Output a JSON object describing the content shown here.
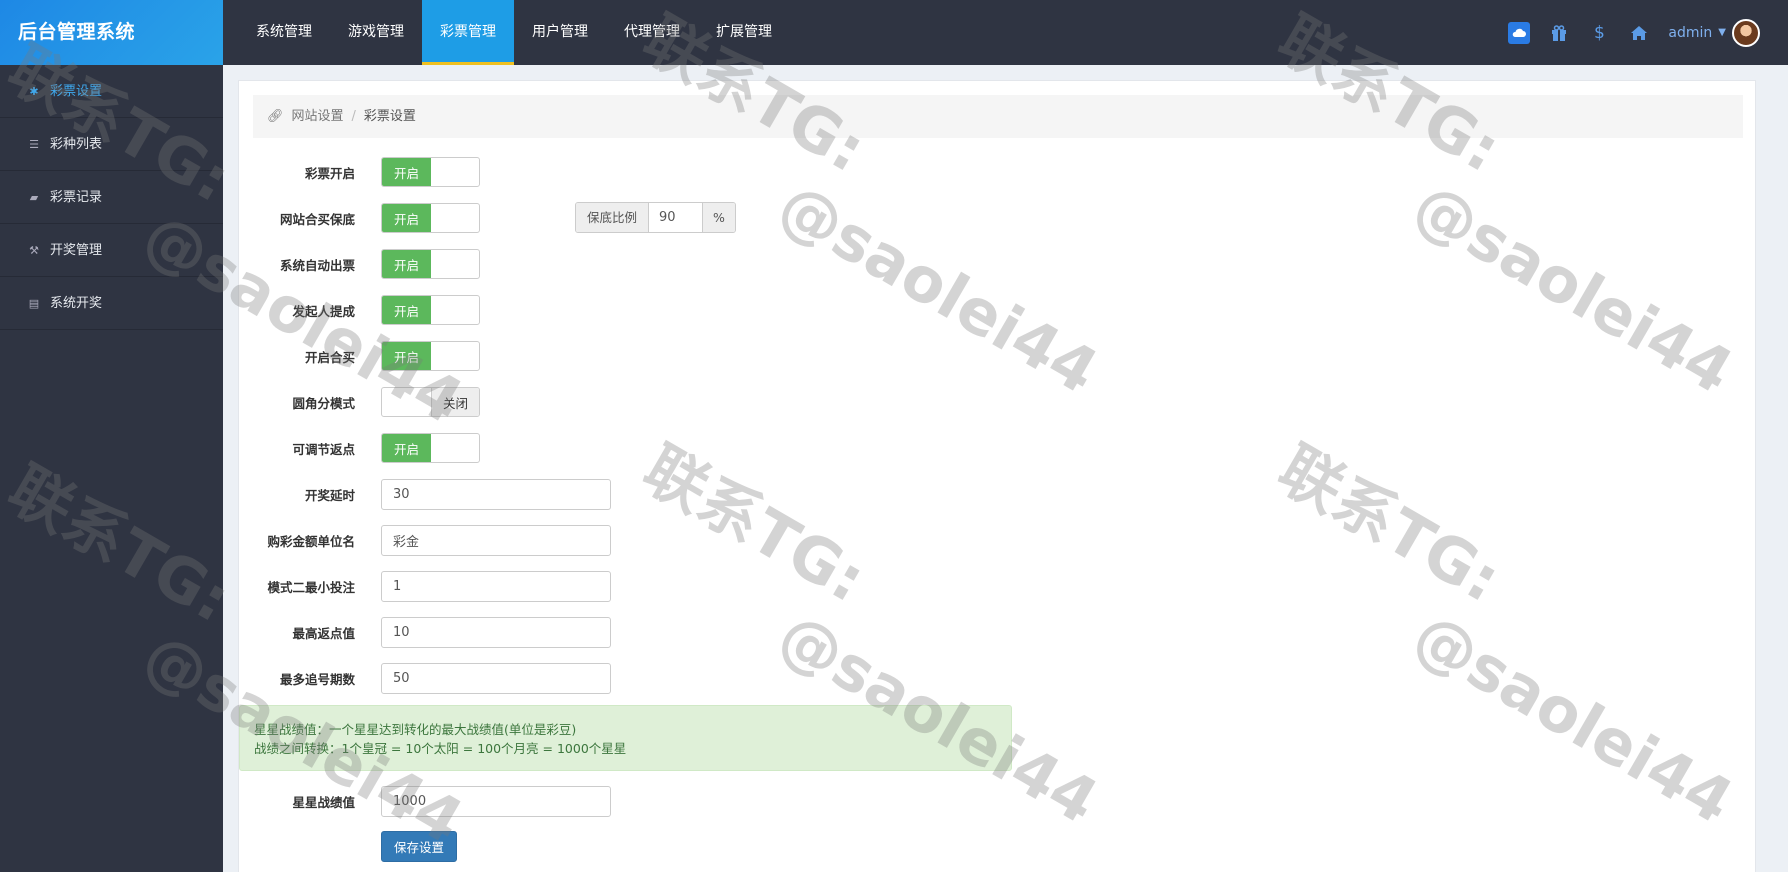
{
  "brand": "后台管理系统",
  "topnav": [
    {
      "label": "系统管理",
      "active": false
    },
    {
      "label": "游戏管理",
      "active": false
    },
    {
      "label": "彩票管理",
      "active": true
    },
    {
      "label": "用户管理",
      "active": false
    },
    {
      "label": "代理管理",
      "active": false
    },
    {
      "label": "扩展管理",
      "active": false
    }
  ],
  "topright": {
    "user": "admin",
    "icons": [
      "cloud-icon",
      "gift-icon",
      "dollar-icon",
      "home-icon"
    ]
  },
  "sidebar": [
    {
      "label": "彩票设置",
      "icon": "gear-icon",
      "active": true
    },
    {
      "label": "彩种列表",
      "icon": "list-icon",
      "active": false
    },
    {
      "label": "彩票记录",
      "icon": "book-icon",
      "active": false
    },
    {
      "label": "开奖管理",
      "icon": "gavel-icon",
      "active": false
    },
    {
      "label": "系统开奖",
      "icon": "newspaper-icon",
      "active": false
    }
  ],
  "breadcrumb": {
    "parent": "网站设置",
    "separator": "/",
    "current": "彩票设置"
  },
  "form": {
    "switches": [
      {
        "label": "彩票开启",
        "state": "开启",
        "on": true
      },
      {
        "label": "网站合买保底",
        "state": "开启",
        "on": true
      },
      {
        "label": "系统自动出票",
        "state": "开启",
        "on": true
      },
      {
        "label": "发起人提成",
        "state": "开启",
        "on": true
      },
      {
        "label": "开启合买",
        "state": "开启",
        "on": true
      },
      {
        "label": "圆角分模式",
        "state": "关闭",
        "on": false
      },
      {
        "label": "可调节返点",
        "state": "开启",
        "on": true
      }
    ],
    "guarantee": {
      "prefix": "保底比例",
      "value": "90",
      "suffix": "%"
    },
    "inputs": [
      {
        "label": "开奖延时",
        "value": "30"
      },
      {
        "label": "购彩金额单位名",
        "value": "彩金"
      },
      {
        "label": "模式二最小投注",
        "value": "1"
      },
      {
        "label": "最高返点值",
        "value": "10"
      },
      {
        "label": "最多追号期数",
        "value": "50"
      }
    ],
    "alert": {
      "line1": "星星战绩值：一个星星达到转化的最大战绩值(单位是彩豆)",
      "line2": "战绩之间转换：1个皇冠 = 10个太阳 = 100个月亮 = 1000个星星"
    },
    "star_score": {
      "label": "星星战绩值",
      "value": "1000"
    },
    "save_label": "保存设置"
  },
  "colors": {
    "topbar": "#2f3442",
    "accent": "#1e9de6",
    "switch_on": "#5cb85c",
    "save": "#337ab7"
  },
  "watermarks": [
    "联系TG:",
    "@saolei44"
  ]
}
